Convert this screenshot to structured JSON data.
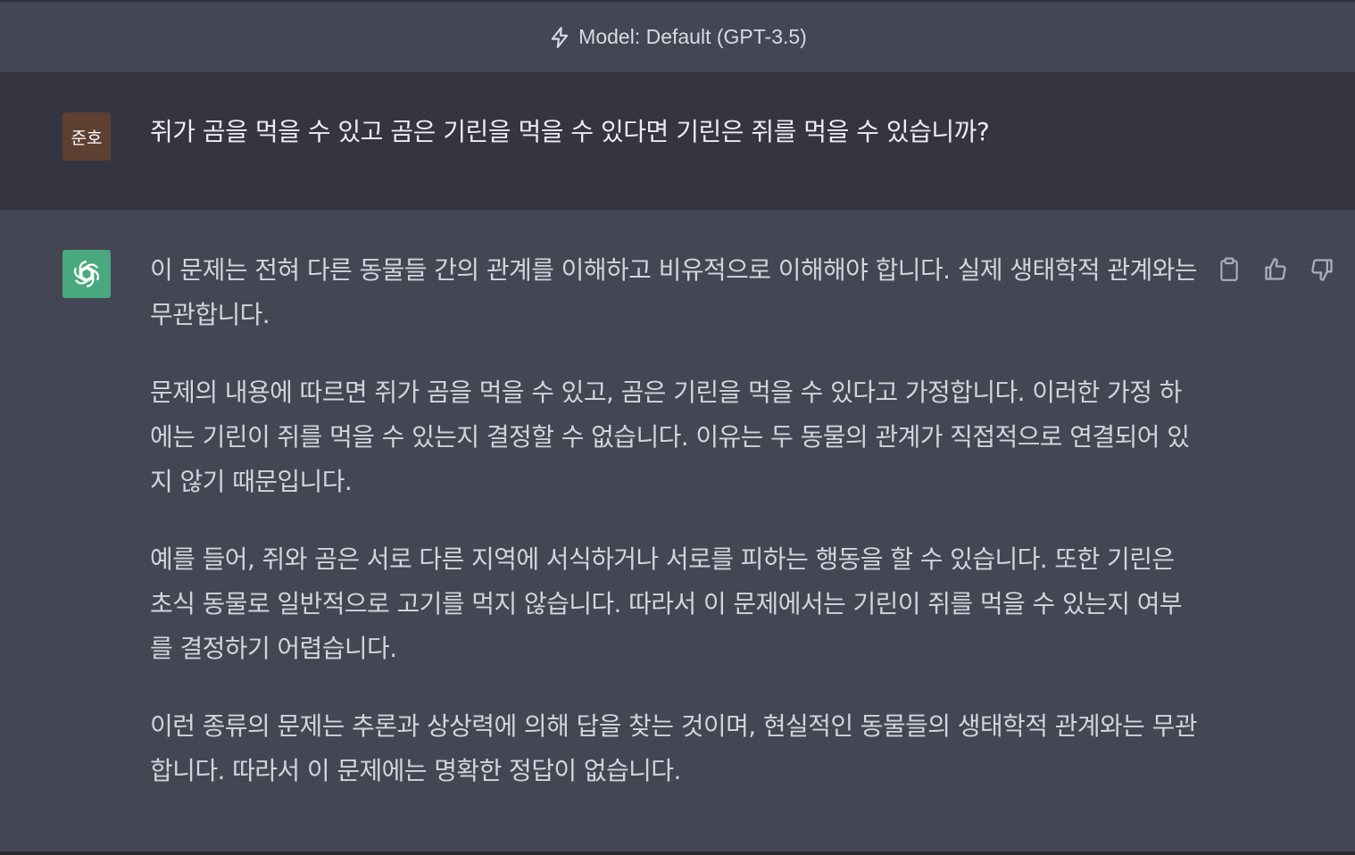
{
  "header": {
    "model_label": "Model: Default (GPT-3.5)",
    "icon": "lightning-bolt-icon"
  },
  "user_message": {
    "avatar_text": "준호",
    "avatar_color": "#5d4032",
    "text": "쥐가 곰을 먹을 수 있고 곰은 기린을 먹을 수 있다면 기린은 쥐를 먹을 수 있습니까?"
  },
  "assistant_message": {
    "avatar_icon": "openai-logo-icon",
    "avatar_color": "#4aa87f",
    "paragraphs": [
      "이 문제는 전혀 다른 동물들 간의 관계를 이해하고 비유적으로 이해해야 합니다. 실제 생태학적 관계와는 무관합니다.",
      "문제의 내용에 따르면 쥐가 곰을 먹을 수 있고, 곰은 기린을 먹을 수 있다고 가정합니다. 이러한 가정 하에는 기린이 쥐를 먹을 수 있는지 결정할 수 없습니다. 이유는 두 동물의 관계가 직접적으로 연결되어 있지 않기 때문입니다.",
      "예를 들어, 쥐와 곰은 서로 다른 지역에 서식하거나 서로를 피하는 행동을 할 수 있습니다. 또한 기린은 초식 동물로 일반적으로 고기를 먹지 않습니다. 따라서 이 문제에서는 기린이 쥐를 먹을 수 있는지 여부를 결정하기 어렵습니다.",
      "이런 종류의 문제는 추론과 상상력에 의해 답을 찾는 것이며, 현실적인 동물들의 생태학적 관계와는 무관합니다. 따라서 이 문제에는 명확한 정답이 없습니다."
    ],
    "actions": [
      "clipboard-icon",
      "thumbs-up-icon",
      "thumbs-down-icon"
    ]
  },
  "colors": {
    "assistant_bg": "#444654",
    "user_bg": "#343541",
    "text": "#d1d5db"
  }
}
